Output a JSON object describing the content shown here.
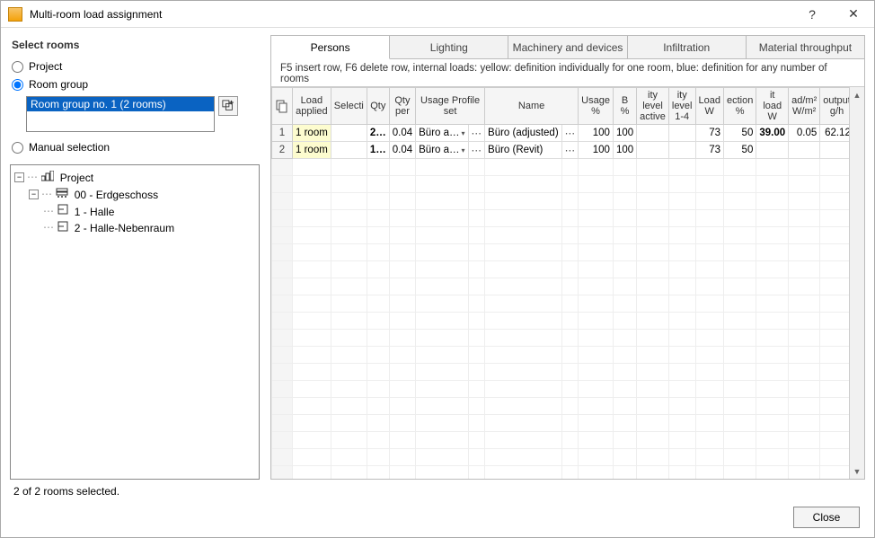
{
  "window": {
    "title": "Multi-room load assignment",
    "help_label": "?",
    "close_glyph": "✕"
  },
  "left": {
    "heading": "Select rooms",
    "radio_project": "Project",
    "radio_room_group": "Room group",
    "radio_manual": "Manual selection",
    "room_group_item": "Room group no. 1 (2 rooms)",
    "tree": {
      "root": "Project",
      "level1": "00 - Erdgeschoss",
      "leaf1": "1 - Halle",
      "leaf2": "2 - Halle-Nebenraum"
    }
  },
  "tabs": {
    "persons": "Persons",
    "lighting": "Lighting",
    "machinery": "Machinery and devices",
    "infiltration": "Infiltration",
    "material": "Material throughput"
  },
  "hint": "F5 insert row, F6 delete row, internal loads: yellow: definition individually for one room, blue: definition for any number of rooms",
  "columns": {
    "load_applied": "Load applied",
    "selection": "Selecti",
    "qty": "Qty",
    "qty_per": "Qty per",
    "usage_profile": "Usage Profile set",
    "name": "Name",
    "usage_pct": "Usage %",
    "b_pct": "B %",
    "ity_level_active": "ity level active",
    "ity_level_14": "ity level 1-4",
    "load_w": "Load W",
    "ection_pct": "ection %",
    "it_load_w": "it load W",
    "ad_m2": "ad/m² W/m²",
    "output_gh": "output g/h",
    "warn": "!"
  },
  "rows": [
    {
      "n": "1",
      "load_applied": "1 room",
      "selection": "",
      "qty": "2…",
      "qty_per": "0.04",
      "usage_profile": "Büro a…",
      "name": "Büro (adjusted)",
      "usage_pct": "100",
      "b_pct": "100",
      "ity_active": "",
      "ity_14": "",
      "load_w": "73",
      "ection_pct": "50",
      "it_load_w": "39.00",
      "ad_m2": "0.05",
      "output_gh": "62.12"
    },
    {
      "n": "2",
      "load_applied": "1 room",
      "selection": "",
      "qty": "1…",
      "qty_per": "0.04",
      "usage_profile": "Büro a…",
      "name": "Büro (Revit)",
      "usage_pct": "100",
      "b_pct": "100",
      "ity_active": "",
      "ity_14": "",
      "load_w": "73",
      "ection_pct": "50",
      "it_load_w": "",
      "ad_m2": "",
      "output_gh": ""
    }
  ],
  "status": "2 of 2 rooms selected.",
  "close_button": "Close"
}
